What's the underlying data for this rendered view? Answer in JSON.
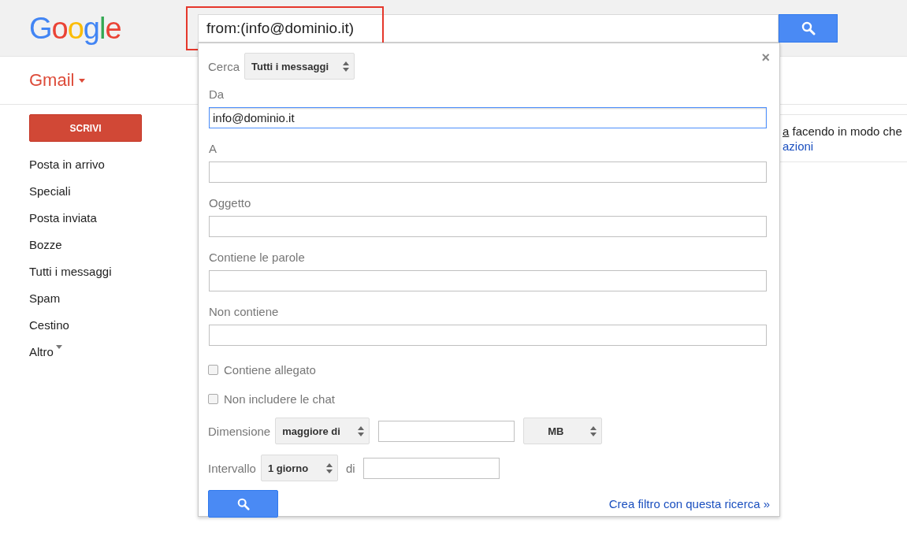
{
  "header": {
    "logo": "Google",
    "search_query": "from:(info@dominio.it)",
    "highlighted": true
  },
  "app_menu": {
    "label": "Gmail"
  },
  "compose": "SCRIVI",
  "nav": [
    {
      "label": "Posta in arrivo",
      "kind": "link"
    },
    {
      "label": "Speciali",
      "kind": "link"
    },
    {
      "label": "Posta inviata",
      "kind": "link"
    },
    {
      "label": "Bozze",
      "kind": "link"
    },
    {
      "label": "Tutti i messaggi",
      "kind": "link"
    },
    {
      "label": "Spam",
      "kind": "link"
    },
    {
      "label": "Cestino",
      "kind": "link"
    },
    {
      "label": "Altro",
      "kind": "menu"
    }
  ],
  "background_text": {
    "underlined": "a",
    "text": " facendo in modo che",
    "link": "azioni"
  },
  "search_panel": {
    "scope_label": "Cerca",
    "scope": "Tutti i messaggi",
    "close": "×",
    "fields": [
      {
        "label": "Da",
        "value": "info@dominio.it",
        "focused": true
      },
      {
        "label": "A",
        "focused": false
      },
      {
        "label": "Oggetto",
        "focused": false
      },
      {
        "label": "Contiene le parole",
        "focused": false
      },
      {
        "label": "Non contiene",
        "focused": false
      }
    ],
    "checkboxes": [
      {
        "label": "Contiene allegato",
        "checked": false
      },
      {
        "label": "Non includere le chat",
        "checked": false
      }
    ],
    "size": {
      "label": "Dimensione",
      "operator": "maggiore di",
      "unit": "MB"
    },
    "interval": {
      "label": "Intervallo",
      "value": "1 giorno",
      "of_label": "di"
    },
    "create_filter": "Crea filtro con questa ricerca »"
  }
}
